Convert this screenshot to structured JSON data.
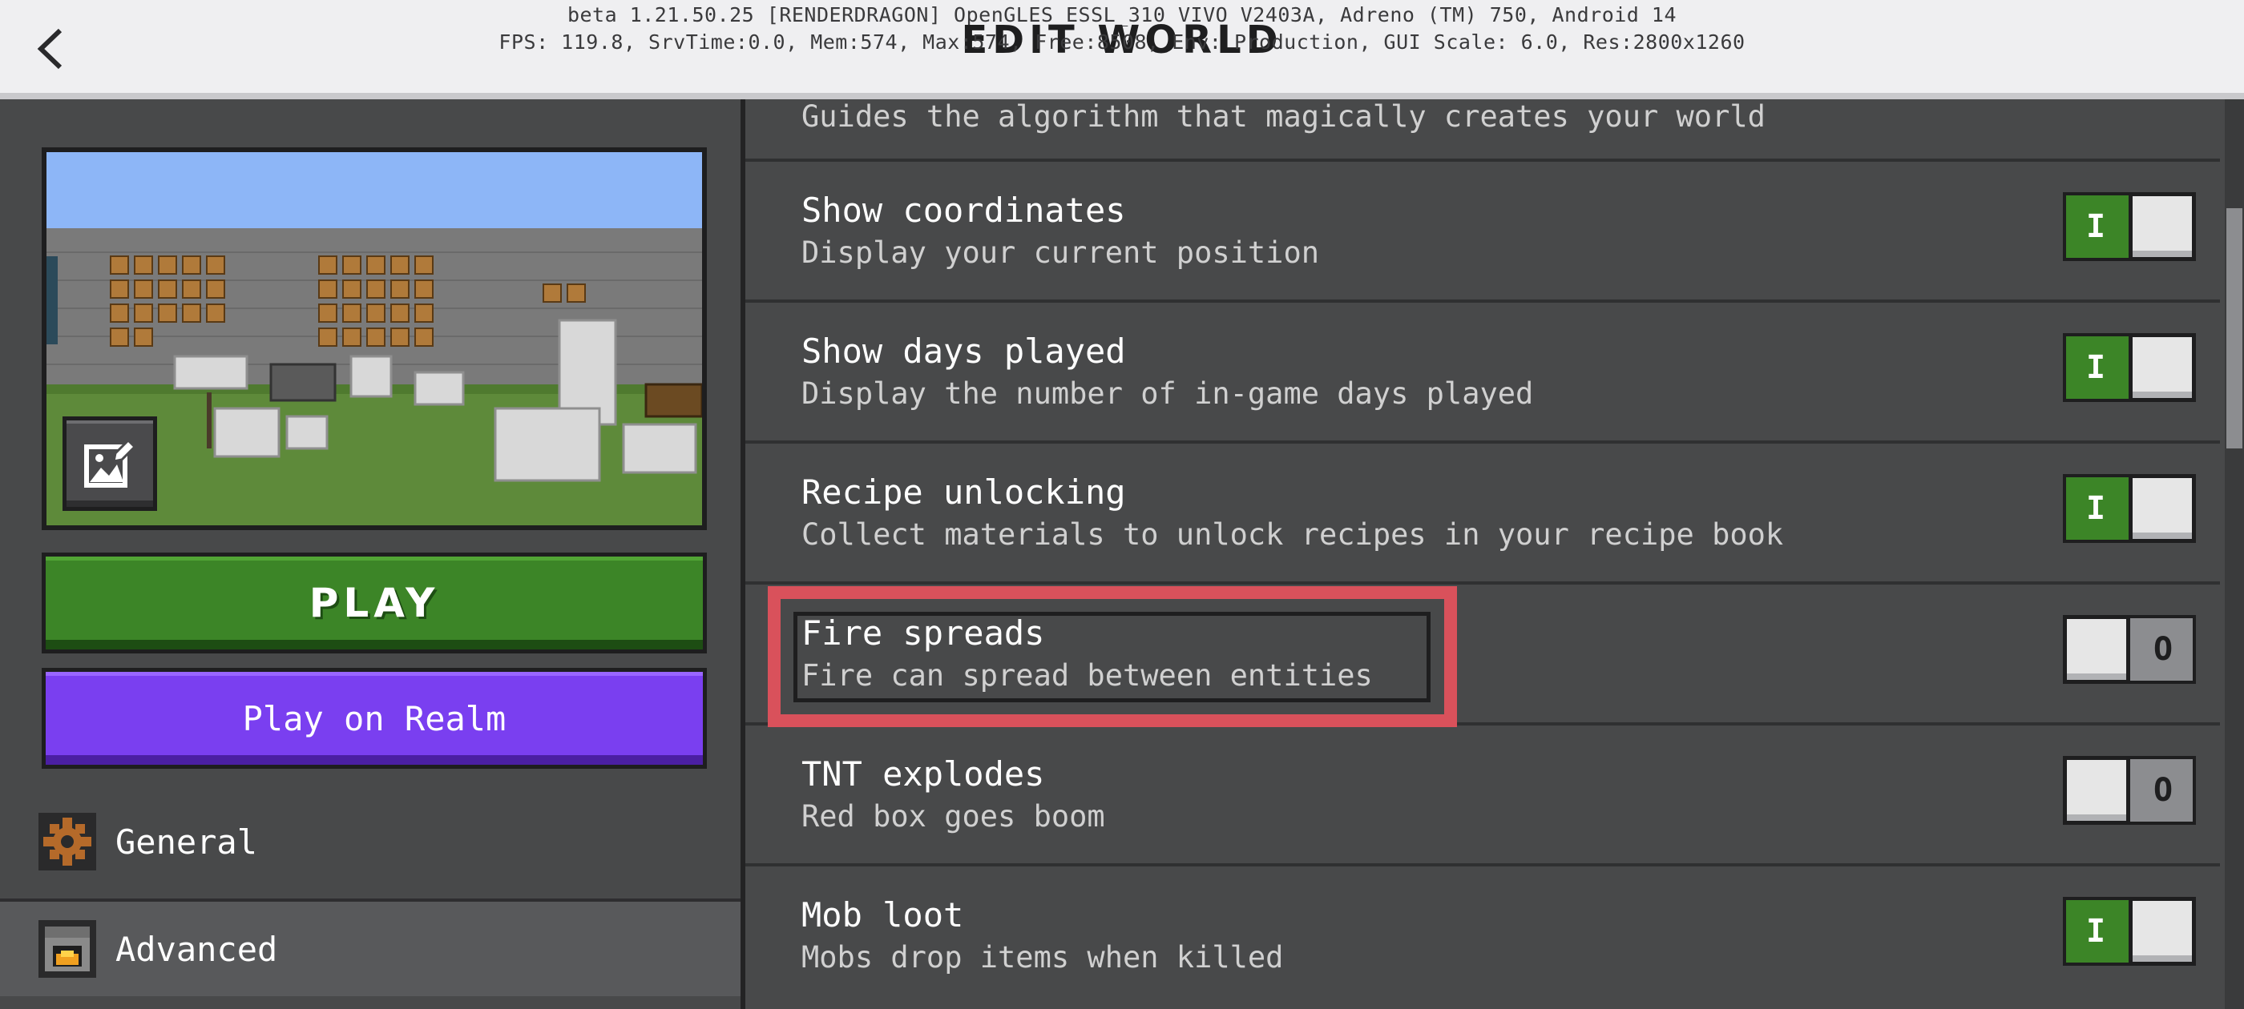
{
  "header": {
    "title": "EDIT WORLD",
    "debug_line1": "beta 1.21.50.25 [RENDERDRAGON] OpenGLES ESSL_310 VIVO V2403A, Adreno (TM) 750, Android 14",
    "debug_line2": "FPS: 119.8, SrvTime:0.0, Mem:574, Max:574, Free:8508, Env: Production, GUI Scale: 6.0, Res:2800x1260",
    "back_icon": "chevron-left-icon"
  },
  "left_panel": {
    "play_label": "PLAY",
    "realm_label": "Play on Realm",
    "nav": [
      {
        "label": "General",
        "icon": "gear-icon"
      },
      {
        "label": "Advanced",
        "icon": "furnace-icon"
      }
    ]
  },
  "settings": {
    "top_partial_desc": "Guides the algorithm that magically creates your world",
    "items": [
      {
        "title": "Show coordinates",
        "desc": "Display your current position",
        "state": "on",
        "mark": "I"
      },
      {
        "title": "Show days played",
        "desc": "Display the number of in-game days played",
        "state": "on",
        "mark": "I"
      },
      {
        "title": "Recipe unlocking",
        "desc": "Collect materials to unlock recipes in your recipe book",
        "state": "on",
        "mark": "I"
      },
      {
        "title": "Fire spreads",
        "desc": "Fire can spread between entities",
        "state": "off",
        "mark": "O"
      },
      {
        "title": "TNT explodes",
        "desc": "Red box goes boom",
        "state": "off",
        "mark": "O"
      },
      {
        "title": "Mob loot",
        "desc": "Mobs drop items when killed",
        "state": "on",
        "mark": "I"
      }
    ]
  },
  "colors": {
    "toggle_on": "#3c8527",
    "play_green": "#3c8527",
    "realm_purple": "#7a3ff0",
    "highlight_red": "#d9515b"
  }
}
